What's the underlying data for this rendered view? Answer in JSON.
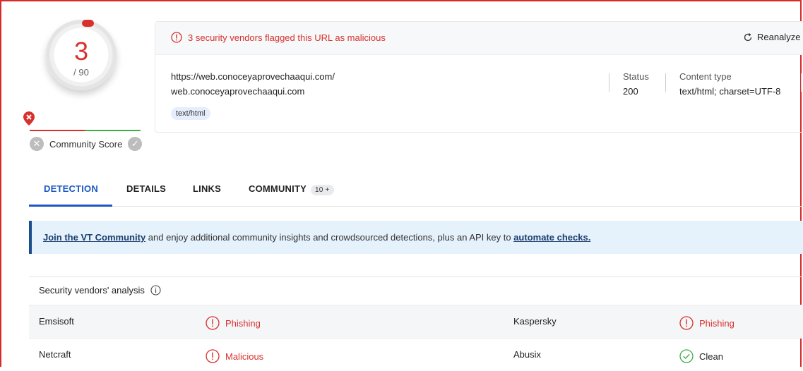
{
  "score": {
    "value": "3",
    "total": "/ 90"
  },
  "community": {
    "label": "Community Score"
  },
  "alert": {
    "text": "3 security vendors flagged this URL as malicious"
  },
  "reanalyze": {
    "label": "Reanalyze"
  },
  "url": {
    "full": "https://web.conoceyaprovechaaqui.com/",
    "domain": "web.conoceyaprovechaaqui.com",
    "tag": "text/html"
  },
  "meta": {
    "status_label": "Status",
    "status_value": "200",
    "content_label": "Content type",
    "content_value": "text/html; charset=UTF-8"
  },
  "tabs": {
    "detection": "DETECTION",
    "details": "DETAILS",
    "links": "LINKS",
    "community": "COMMUNITY",
    "community_badge": "10 +"
  },
  "banner": {
    "link1": "Join the VT Community",
    "middle": " and enjoy additional community insights and crowdsourced detections, plus an API key to ",
    "link2": "automate checks."
  },
  "vendors": {
    "title": "Security vendors' analysis",
    "rows": [
      {
        "left_name": "Emsisoft",
        "left_result": "Phishing",
        "right_name": "Kaspersky",
        "right_result": "Phishing"
      },
      {
        "left_name": "Netcraft",
        "left_result": "Malicious",
        "right_name": "Abusix",
        "right_result": "Clean"
      }
    ]
  },
  "colors": {
    "malicious": "#d7312e",
    "clean": "#3fae49",
    "accent": "#1a56c4"
  }
}
